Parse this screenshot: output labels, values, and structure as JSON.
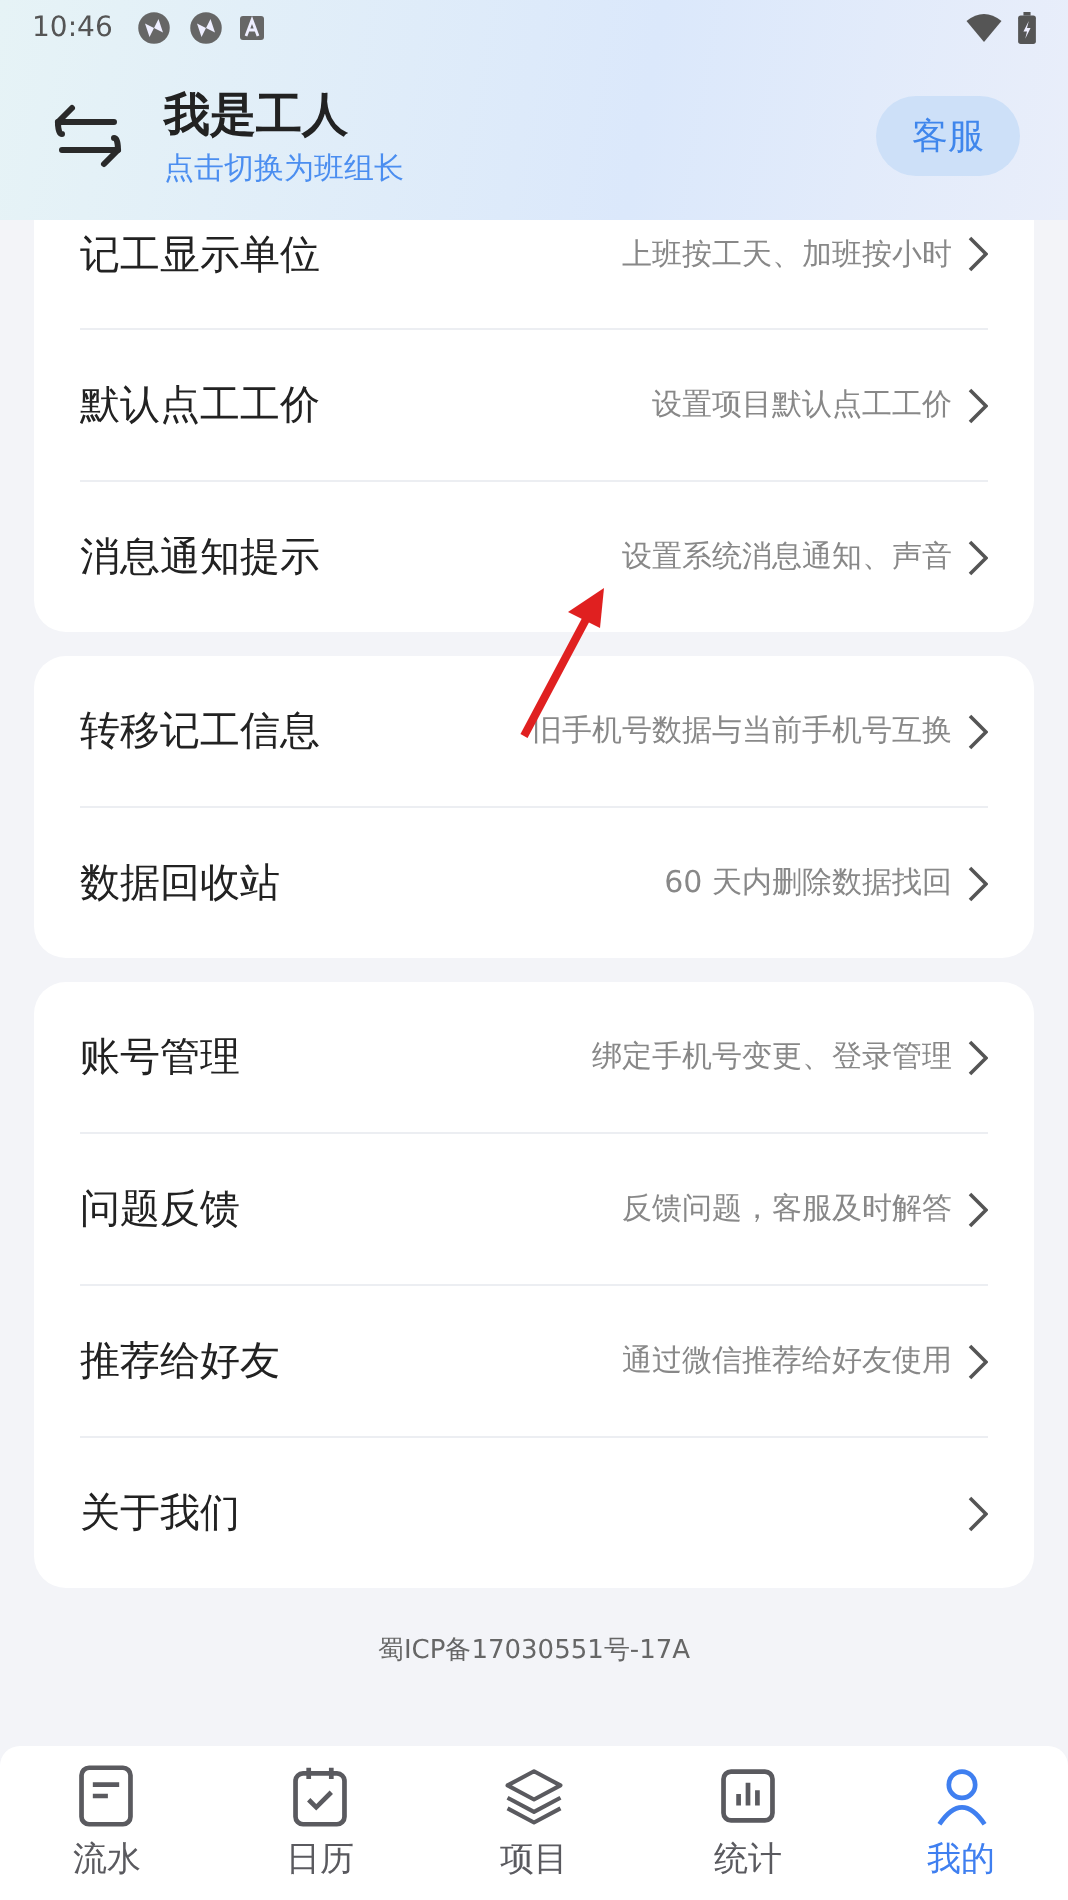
{
  "status_bar": {
    "time": "10:46"
  },
  "header": {
    "title": "我是工人",
    "subtitle": "点击切换为班组长",
    "service_button": "客服"
  },
  "groups": [
    {
      "items": [
        {
          "label": "记工显示单位",
          "detail": "上班按工天、加班按小时"
        },
        {
          "label": "默认点工工价",
          "detail": "设置项目默认点工工价"
        },
        {
          "label": "消息通知提示",
          "detail": "设置系统消息通知、声音"
        }
      ]
    },
    {
      "items": [
        {
          "label": "转移记工信息",
          "detail": "旧手机号数据与当前手机号互换"
        },
        {
          "label": "数据回收站",
          "detail": "60 天内删除数据找回"
        }
      ]
    },
    {
      "items": [
        {
          "label": "账号管理",
          "detail": "绑定手机号变更、登录管理"
        },
        {
          "label": "问题反馈",
          "detail": "反馈问题，客服及时解答"
        },
        {
          "label": "推荐给好友",
          "detail": "通过微信推荐给好友使用"
        },
        {
          "label": "关于我们"
        }
      ]
    }
  ],
  "footer": "蜀ICP备17030551号-17A",
  "nav": [
    {
      "label": "流水",
      "kind": "list",
      "selected": false
    },
    {
      "label": "日历",
      "kind": "calendar",
      "selected": false
    },
    {
      "label": "项目",
      "kind": "layers",
      "selected": false
    },
    {
      "label": "统计",
      "kind": "chart",
      "selected": false
    },
    {
      "label": "我的",
      "kind": "person",
      "selected": true
    }
  ]
}
